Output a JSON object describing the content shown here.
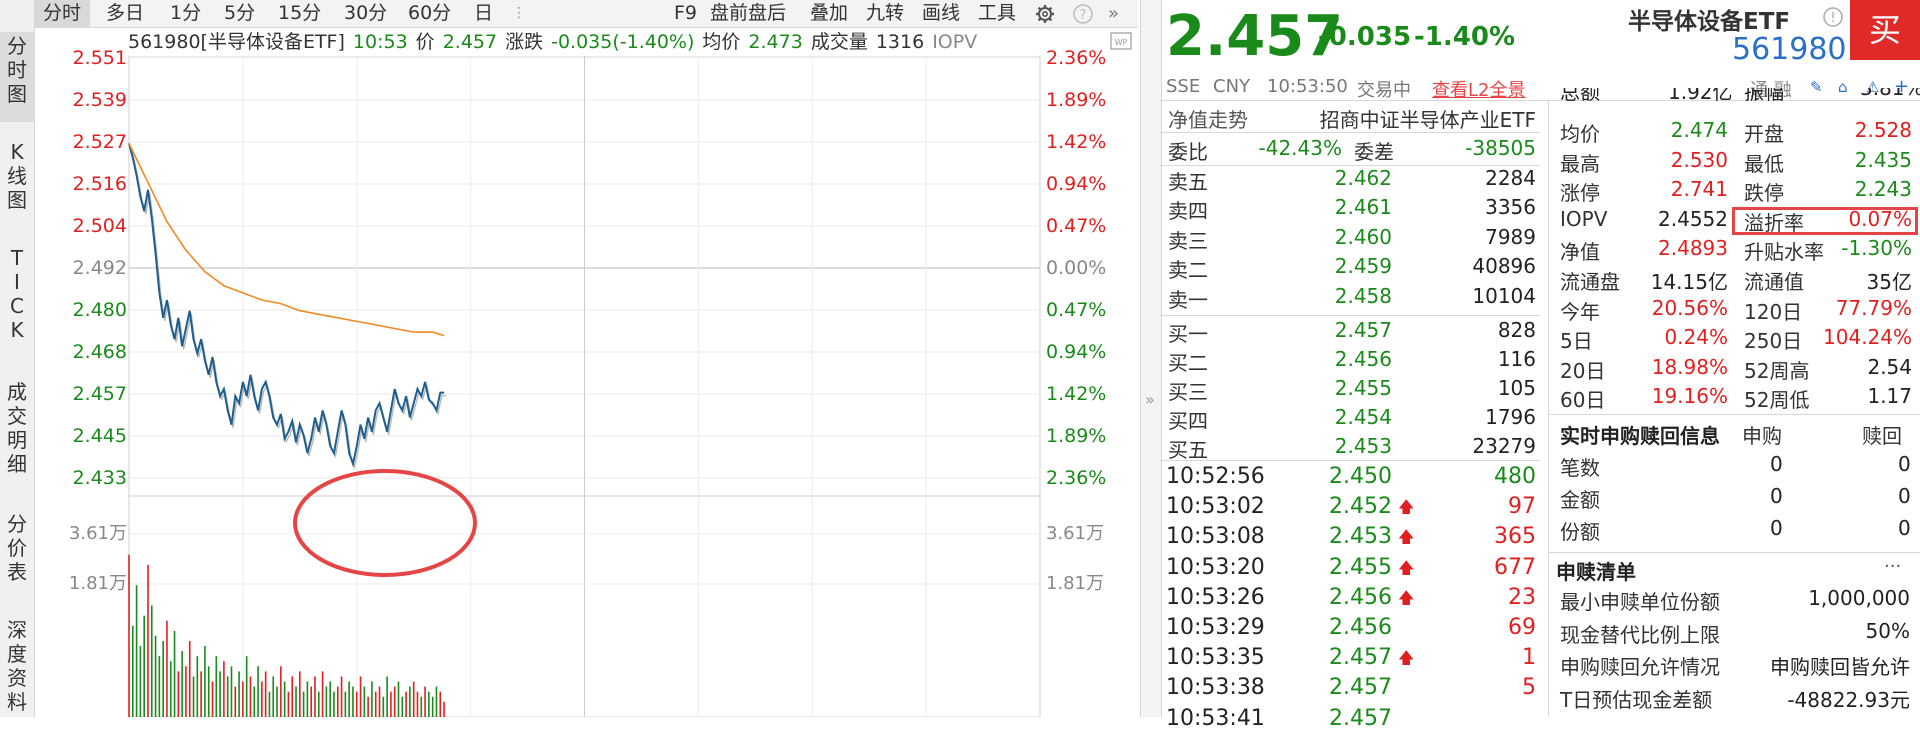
{
  "vertical_tabs": [
    {
      "label": "分\n时\n图",
      "active": true
    },
    {
      "label": "K\n线\n图",
      "active": false
    },
    {
      "label": "T\nI\nC\nK",
      "active": false
    },
    {
      "label": "成\n交\n明\n细",
      "active": false
    },
    {
      "label": "分\n价\n表",
      "active": false
    },
    {
      "label": "深\n度\n资\n料",
      "active": false
    }
  ],
  "toolbar": {
    "period_tabs": [
      "分时",
      "多日",
      "1分",
      "5分",
      "15分",
      "30分",
      "60分",
      "日"
    ],
    "right_items": [
      "F9",
      "盘前盘后",
      "叠加",
      "九转",
      "画线",
      "工具"
    ],
    "settings_icon": "gear-icon",
    "help_icon": "help-icon",
    "expand_icon": "double-chevron-right-icon"
  },
  "info_line": {
    "code_name": "561980[半导体设备ETF]",
    "time": "10:53",
    "price_label": "价",
    "price": "2.457",
    "change_label": "涨跌",
    "change": "-0.035(-1.40%)",
    "avg_label": "均价",
    "avg": "2.473",
    "volume_label": "成交量",
    "volume": "1316",
    "iopv": "IOPV"
  },
  "chart_data": {
    "type": "line",
    "title": "",
    "prev_close": 2.492,
    "y_axis_left": [
      "2.551",
      "2.539",
      "2.527",
      "2.516",
      "2.504",
      "2.492",
      "2.480",
      "2.468",
      "2.457",
      "2.445",
      "2.433"
    ],
    "y_axis_right": [
      "2.36%",
      "1.89%",
      "1.42%",
      "0.94%",
      "0.47%",
      "0.00%",
      "0.47%",
      "0.94%",
      "1.42%",
      "1.89%",
      "2.36%"
    ],
    "volume_axis": [
      "3.61万",
      "1.81万"
    ],
    "session_minutes": 240,
    "series": [
      {
        "name": "",
        "color": "#1f5f8f",
        "x_minutes": [
          0,
          1,
          2,
          3,
          4,
          5,
          6,
          7,
          8,
          9,
          10,
          11,
          12,
          13,
          14,
          15,
          16,
          17,
          18,
          19,
          20,
          21,
          22,
          23,
          24,
          25,
          26,
          27,
          28,
          29,
          30,
          31,
          32,
          33,
          34,
          35,
          36,
          37,
          38,
          39,
          40,
          41,
          42,
          43,
          44,
          45,
          46,
          47,
          48,
          49,
          50,
          51,
          52,
          53,
          54,
          55,
          56,
          57,
          58,
          59,
          60,
          61,
          62,
          63,
          64,
          65,
          66,
          67,
          68,
          69,
          70,
          71,
          72,
          73,
          74,
          75,
          76,
          77,
          78,
          79,
          80,
          81,
          82,
          83
        ],
        "values": [
          2.527,
          2.523,
          2.518,
          2.512,
          2.508,
          2.514,
          2.506,
          2.496,
          2.485,
          2.478,
          2.483,
          2.476,
          2.472,
          2.478,
          2.47,
          2.475,
          2.48,
          2.472,
          2.468,
          2.472,
          2.466,
          2.462,
          2.467,
          2.46,
          2.456,
          2.458,
          2.452,
          2.448,
          2.456,
          2.454,
          2.46,
          2.456,
          2.462,
          2.456,
          2.452,
          2.458,
          2.46,
          2.456,
          2.45,
          2.448,
          2.451,
          2.444,
          2.446,
          2.449,
          2.443,
          2.448,
          2.445,
          2.44,
          2.444,
          2.45,
          2.446,
          2.452,
          2.448,
          2.442,
          2.44,
          2.446,
          2.452,
          2.448,
          2.44,
          2.437,
          2.442,
          2.448,
          2.444,
          2.45,
          2.446,
          2.452,
          2.454,
          2.45,
          2.446,
          2.452,
          2.458,
          2.454,
          2.452,
          2.456,
          2.45,
          2.454,
          2.458,
          2.456,
          2.46,
          2.455,
          2.454,
          2.452,
          2.457,
          2.457
        ]
      },
      {
        "name": "",
        "color": "#f08a24",
        "x_minutes": [
          0,
          5,
          10,
          15,
          20,
          25,
          30,
          35,
          40,
          45,
          50,
          55,
          60,
          65,
          70,
          75,
          80,
          83
        ],
        "values": [
          2.527,
          2.516,
          2.505,
          2.497,
          2.491,
          2.487,
          2.485,
          2.483,
          2.482,
          2.48,
          2.479,
          2.478,
          2.477,
          2.476,
          2.475,
          2.474,
          2.474,
          2.473
        ]
      }
    ],
    "volumes": [
      32000,
      18000,
      26000,
      14000,
      20000,
      30000,
      22000,
      16000,
      12000,
      15000,
      19000,
      11000,
      17000,
      9000,
      13000,
      10000,
      15000,
      8000,
      12000,
      9000,
      14000,
      10000,
      7000,
      12000,
      9000,
      11000,
      8000,
      10000,
      6000,
      9000,
      7000,
      12000,
      8000,
      6000,
      10000,
      7000,
      9000,
      5000,
      8000,
      6000,
      10000,
      7000,
      5000,
      8000,
      6000,
      9000,
      5000,
      7000,
      6000,
      8000,
      5000,
      9000,
      6000,
      7000,
      5000,
      6000,
      8000,
      5000,
      7000,
      6000,
      5000,
      8000,
      6000,
      4000,
      7000,
      5000,
      6000,
      4000,
      8000,
      5000,
      6000,
      7000,
      4000,
      5000,
      6000,
      7000,
      5000,
      4000,
      6000,
      5000,
      4000,
      6000,
      5000,
      3000
    ]
  },
  "quote": {
    "price": "2.457",
    "change": "-0.035",
    "change_pct": "-1.40%",
    "name": "半导体设备ETF",
    "code": "561980",
    "buy_button": "买",
    "market": "SSE",
    "currency": "CNY",
    "time": "10:53:50",
    "status": "交易中",
    "l2_link": "查看L2全景",
    "tool_label": "通 融"
  },
  "nav_row": {
    "label": "净值走势",
    "value": "招商中证半导体产业ETF"
  },
  "weibi": {
    "label1": "委比",
    "value1": "-42.43%",
    "label2": "委差",
    "value2": "-38505"
  },
  "asks": [
    {
      "label": "卖五",
      "price": "2.462",
      "vol": "2284"
    },
    {
      "label": "卖四",
      "price": "2.461",
      "vol": "3356"
    },
    {
      "label": "卖三",
      "price": "2.460",
      "vol": "7989"
    },
    {
      "label": "卖二",
      "price": "2.459",
      "vol": "40896"
    },
    {
      "label": "卖一",
      "price": "2.458",
      "vol": "10104"
    }
  ],
  "bids": [
    {
      "label": "买一",
      "price": "2.457",
      "vol": "828"
    },
    {
      "label": "买二",
      "price": "2.456",
      "vol": "116"
    },
    {
      "label": "买三",
      "price": "2.455",
      "vol": "105"
    },
    {
      "label": "买四",
      "price": "2.454",
      "vol": "1796"
    },
    {
      "label": "买五",
      "price": "2.453",
      "vol": "23279"
    }
  ],
  "ticks": [
    {
      "time": "10:52:56",
      "price": "2.450",
      "up": false,
      "vol": "480",
      "vol_color": "green"
    },
    {
      "time": "10:53:02",
      "price": "2.452",
      "up": true,
      "vol": "97",
      "vol_color": "red"
    },
    {
      "time": "10:53:08",
      "price": "2.453",
      "up": true,
      "vol": "365",
      "vol_color": "red"
    },
    {
      "time": "10:53:20",
      "price": "2.455",
      "up": true,
      "vol": "677",
      "vol_color": "red"
    },
    {
      "time": "10:53:26",
      "price": "2.456",
      "up": true,
      "vol": "23",
      "vol_color": "red"
    },
    {
      "time": "10:53:29",
      "price": "2.456",
      "up": false,
      "vol": "69",
      "vol_color": "red"
    },
    {
      "time": "10:53:35",
      "price": "2.457",
      "up": true,
      "vol": "1",
      "vol_color": "red"
    },
    {
      "time": "10:53:38",
      "price": "2.457",
      "up": false,
      "vol": "5",
      "vol_color": "red"
    },
    {
      "time": "10:53:41",
      "price": "2.457",
      "up": false,
      "vol": "",
      "vol_color": "red"
    }
  ],
  "stats_top_partial": {
    "l1": "总额",
    "v1": "1.92亿",
    "l2": "振幅",
    "v2": "3.81%"
  },
  "stats": [
    {
      "l1": "均价",
      "v1": "2.474",
      "c1": "green",
      "l2": "开盘",
      "v2": "2.528",
      "c2": "red"
    },
    {
      "l1": "最高",
      "v1": "2.530",
      "c1": "red",
      "l2": "最低",
      "v2": "2.435",
      "c2": "green"
    },
    {
      "l1": "涨停",
      "v1": "2.741",
      "c1": "red",
      "l2": "跌停",
      "v2": "2.243",
      "c2": "green"
    },
    {
      "l1": "IOPV",
      "v1": "2.4552",
      "c1": "dark",
      "l2": "溢折率",
      "v2": "0.07%",
      "c2": "red"
    },
    {
      "l1": "净值",
      "v1": "2.4893",
      "c1": "red",
      "l2": "升贴水率",
      "v2": "-1.30%",
      "c2": "green"
    },
    {
      "l1": "流通盘",
      "v1": "14.15亿",
      "c1": "dark",
      "l2": "流通值",
      "v2": "35亿",
      "c2": "dark"
    },
    {
      "l1": "今年",
      "v1": "20.56%",
      "c1": "red",
      "l2": "120日",
      "v2": "77.79%",
      "c2": "red"
    },
    {
      "l1": "5日",
      "v1": "0.24%",
      "c1": "red",
      "l2": "250日",
      "v2": "104.24%",
      "c2": "red"
    },
    {
      "l1": "20日",
      "v1": "18.98%",
      "c1": "red",
      "l2": "52周高",
      "v2": "2.54",
      "c2": "dark"
    },
    {
      "l1": "60日",
      "v1": "19.16%",
      "c1": "red",
      "l2": "52周低",
      "v2": "1.17",
      "c2": "dark"
    }
  ],
  "subscribe": {
    "title": "实时申购赎回信息",
    "col1": "申购",
    "col2": "赎回",
    "rows": [
      {
        "label": "笔数",
        "a": "0",
        "b": "0"
      },
      {
        "label": "金额",
        "a": "0",
        "b": "0"
      },
      {
        "label": "份额",
        "a": "0",
        "b": "0"
      }
    ]
  },
  "redeem_list": {
    "title": "申赎清单",
    "more": "···",
    "rows": [
      {
        "label": "最小申赎单位份额",
        "value": "1,000,000"
      },
      {
        "label": "现金替代比例上限",
        "value": "50%"
      },
      {
        "label": "申购赎回允许情况",
        "value": "申购赎回皆允许"
      },
      {
        "label": "T日预估现金差额",
        "value": "-48822.93元"
      }
    ]
  },
  "colors": {
    "up": "#e02020",
    "down": "#1a8a1a",
    "price_line": "#1f5f8f",
    "avg_line": "#f08a24",
    "highlight": "#e64545"
  }
}
